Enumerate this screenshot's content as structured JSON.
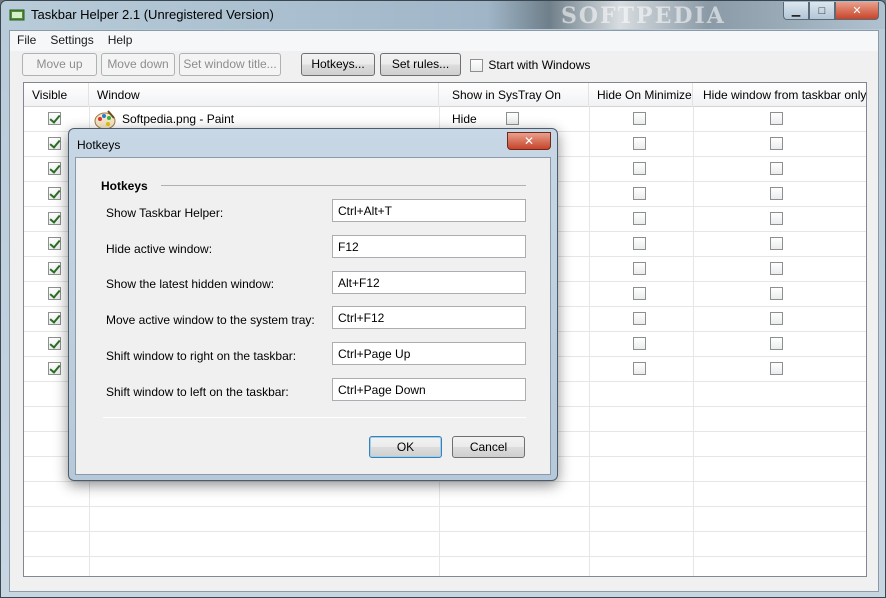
{
  "window": {
    "title": "Taskbar Helper 2.1 (Unregistered Version)",
    "watermark": "SOFTPEDIA",
    "controls": {
      "minimize": "▁",
      "maximize": "□",
      "close": "✕"
    }
  },
  "menu": [
    "File",
    "Settings",
    "Help"
  ],
  "toolbar": {
    "move_up": "Move up",
    "move_down": "Move down",
    "set_title": "Set window title...",
    "hotkeys": "Hotkeys...",
    "set_rules": "Set rules...",
    "start_with_windows": "Start with Windows"
  },
  "table": {
    "columns": [
      "Visible",
      "Window",
      "Show in SysTray On Hide",
      "Hide On Minimize",
      "Hide window from taskbar only"
    ],
    "rows": [
      {
        "visible": true,
        "window": "Softpedia.png - Paint"
      },
      {
        "visible": true,
        "window": ""
      },
      {
        "visible": true,
        "window": ""
      },
      {
        "visible": true,
        "window": ""
      },
      {
        "visible": true,
        "window": ""
      },
      {
        "visible": true,
        "window": ""
      },
      {
        "visible": true,
        "window": ""
      },
      {
        "visible": true,
        "window": ""
      },
      {
        "visible": true,
        "window": ""
      },
      {
        "visible": true,
        "window": ""
      },
      {
        "visible": true,
        "window": ""
      }
    ]
  },
  "dialog": {
    "title": "Hotkeys",
    "close": "✕",
    "group": "Hotkeys",
    "hotkeys": [
      {
        "label": "Show Taskbar Helper:",
        "value": "Ctrl+Alt+T"
      },
      {
        "label": "Hide active window:",
        "value": "F12"
      },
      {
        "label": "Show the latest hidden window:",
        "value": "Alt+F12"
      },
      {
        "label": "Move active window to the system tray:",
        "value": "Ctrl+F12"
      },
      {
        "label": "Shift window to right on the taskbar:",
        "value": "Ctrl+Page Up"
      },
      {
        "label": "Shift window to left on the taskbar:",
        "value": "Ctrl+Page Down"
      }
    ],
    "ok": "OK",
    "cancel": "Cancel"
  }
}
